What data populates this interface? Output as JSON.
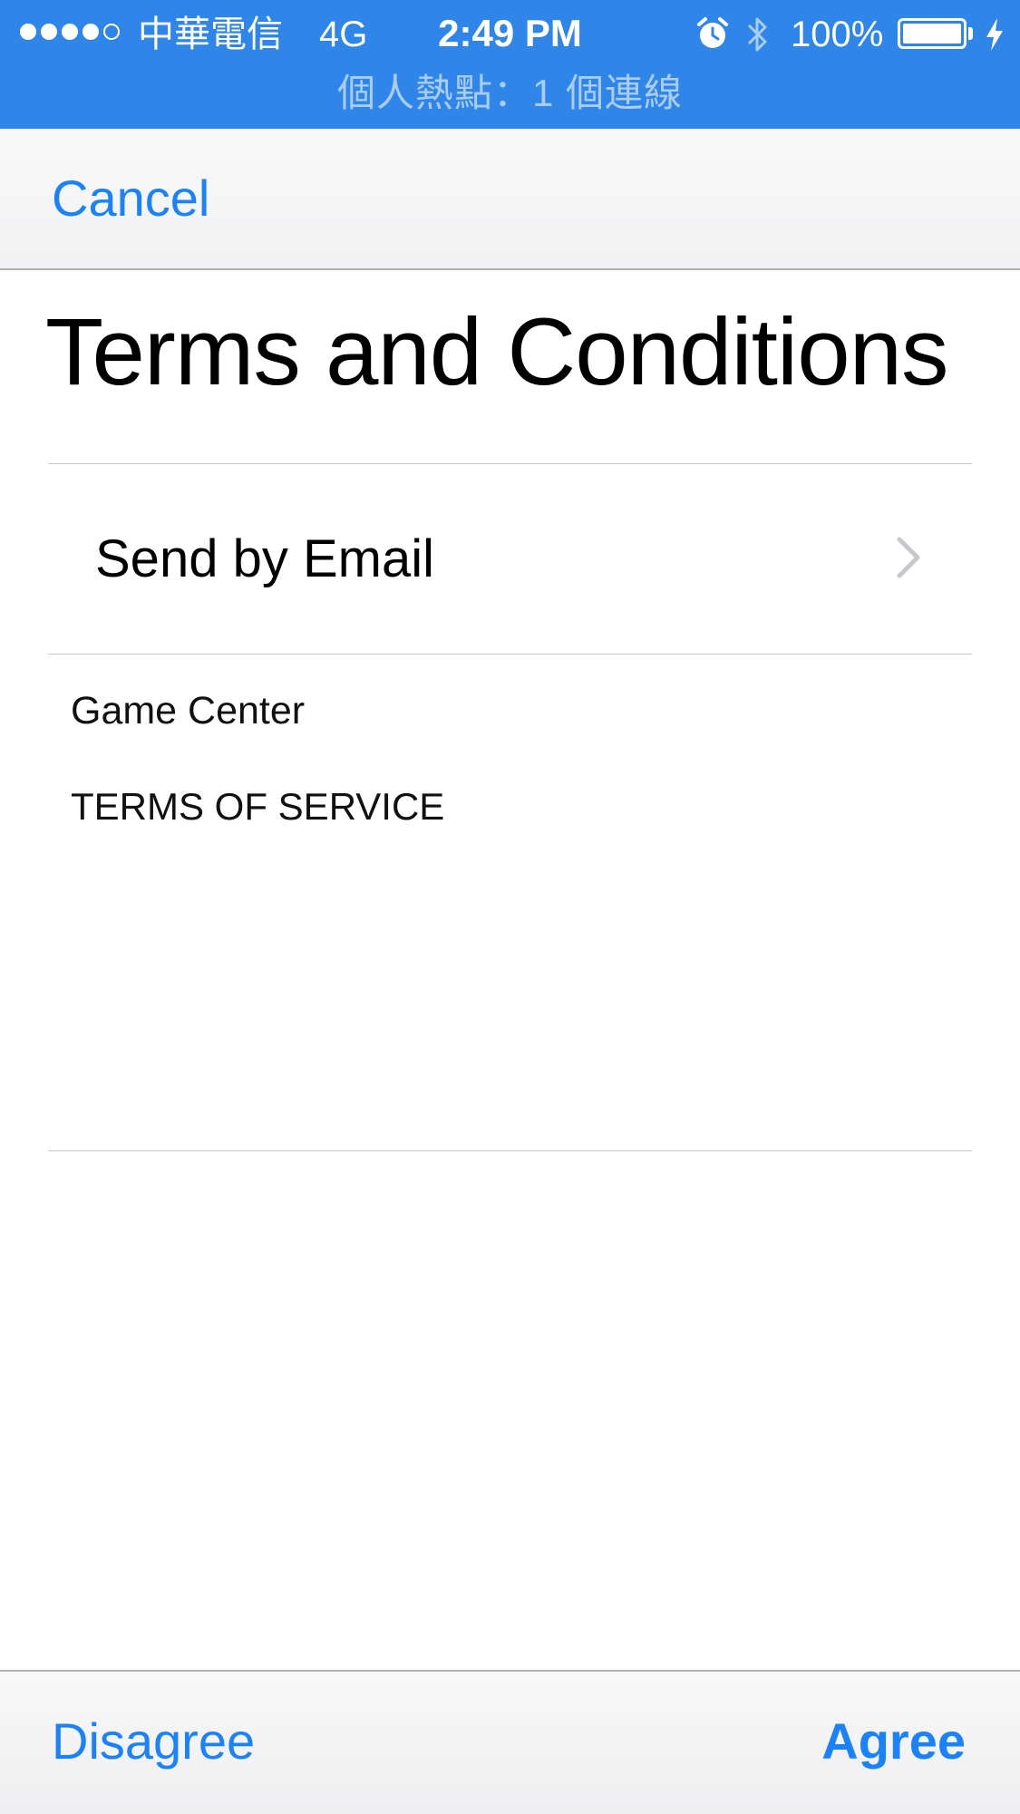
{
  "status_bar": {
    "signal_dots_filled": 4,
    "signal_dots_total": 5,
    "carrier": "中華電信",
    "network": "4G",
    "time": "2:49 PM",
    "battery_percent": "100%",
    "hotspot_text": "個人熱點：1 個連線",
    "icons": [
      "alarm-icon",
      "bluetooth-icon",
      "battery-icon",
      "charging-icon"
    ]
  },
  "nav": {
    "cancel_label": "Cancel"
  },
  "content": {
    "title": "Terms and Conditions",
    "send_by_email_label": "Send by Email",
    "document_heading": "Game Center",
    "document_subheading": "TERMS OF SERVICE"
  },
  "toolbar": {
    "disagree_label": "Disagree",
    "agree_label": "Agree"
  },
  "colors": {
    "status_bar_bg": "#2f86e8",
    "accent": "#1a82fb",
    "separator": "#c8c7cc"
  }
}
